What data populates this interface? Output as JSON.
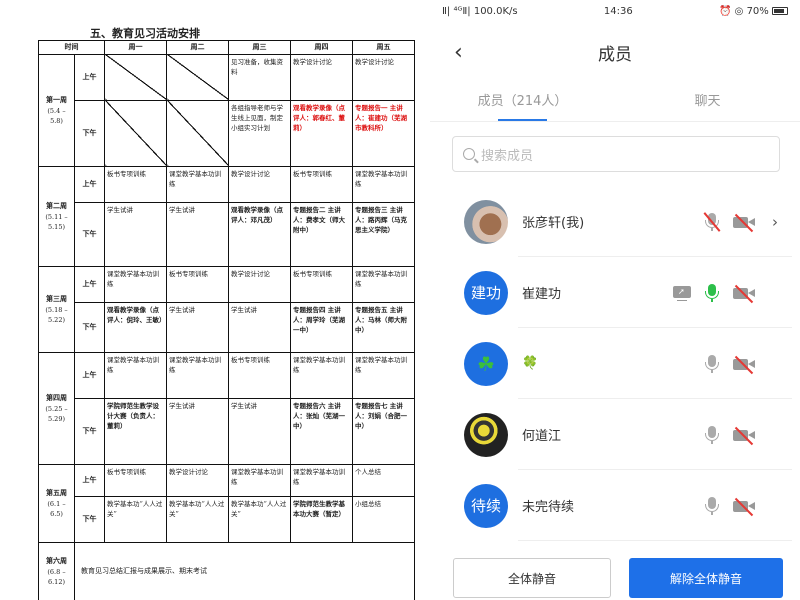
{
  "document": {
    "title": "五、教育见习活动安排",
    "headers": [
      "时间",
      "周一",
      "周二",
      "周三",
      "周四",
      "周五"
    ],
    "am": "上午",
    "pm": "下午",
    "weeks": [
      {
        "name": "第一周",
        "range": "(5.4 –5.8)",
        "am": [
          "",
          "",
          "见习准备，收集资料",
          "教学设计讨论",
          "教学设计讨论"
        ],
        "pm": [
          "",
          "",
          "各组指导老师与学生线上见面，制定小组实习计划",
          "观看教学录像（点评人：郭春红、董莉）",
          "专题报告一 主讲人：崔建功（芜湖市教科所）"
        ]
      },
      {
        "name": "第二周",
        "range": "(5.11 –5.15)",
        "am": [
          "板书专项训练",
          "课堂教学基本功训练",
          "教学设计讨论",
          "板书专项训练",
          "课堂教学基本功训练"
        ],
        "pm": [
          "学生试讲",
          "学生试讲",
          "观看教学录像（点评人：邓凡茂）",
          "专题报告二 主讲人：费孝文（师大附中）",
          "专题报告三 主讲人：路丙辉（马克思主义学院）"
        ]
      },
      {
        "name": "第三周",
        "range": "(5.18 –5.22)",
        "am": [
          "课堂教学基本功训练",
          "板书专项训练",
          "教学设计讨论",
          "板书专项训练",
          "课堂教学基本功训练"
        ],
        "pm": [
          "观看教学录像（点评人：倪玲、王敏）",
          "学生试讲",
          "学生试讲",
          "专题报告四 主讲人：周学玲（芜湖一中）",
          "专题报告五 主讲人：马林（师大附中）"
        ]
      },
      {
        "name": "第四周",
        "range": "(5.25 –5.29)",
        "am": [
          "课堂教学基本功训练",
          "课堂教学基本功训练",
          "板书专项训练",
          "课堂教学基本功训练",
          "课堂教学基本功训练"
        ],
        "pm": [
          "学院师范生教学设计大赛（负责人：董莉）",
          "学生试讲",
          "学生试讲",
          "专题报告六 主讲人：张灿（芜湖一中）",
          "专题报告七 主讲人：刘娟（合肥一中）"
        ]
      },
      {
        "name": "第五周",
        "range": "(6.1 –6.5)",
        "am": [
          "板书专项训练",
          "教学设计讨论",
          "课堂教学基本功训练",
          "课堂教学基本功训练",
          "个人总结"
        ],
        "pm": [
          "教学基本功“人人过关”",
          "教学基本功“人人过关”",
          "教学基本功“人人过关”",
          "学院师范生教学基本功大赛（暂定）",
          "小组总结"
        ]
      },
      {
        "name": "第六周",
        "range": "(6.8 –6.12)",
        "merged": "教育见习总结汇报与成果展示、期末考试"
      }
    ]
  },
  "status_bar": {
    "left": "Ⅱ| ⁴ᴳⅡ| 100.0K/s",
    "time": "14:36",
    "battery": "70%"
  },
  "header": {
    "title": "成员",
    "back": "‹"
  },
  "tabs": [
    {
      "label": "成员（214人）"
    },
    {
      "label": "聊天"
    }
  ],
  "search": {
    "placeholder": "搜索成员"
  },
  "members": [
    {
      "avatar_text": "",
      "name": "张彦轩(我)",
      "mic": "muted",
      "camera": "off",
      "screen": false,
      "chevron": "›"
    },
    {
      "avatar_text": "建功",
      "name": "崔建功",
      "mic": "active",
      "camera": "off",
      "screen": true
    },
    {
      "avatar_text": "",
      "name": "🍀",
      "mic": "normal",
      "camera": "off",
      "screen": false
    },
    {
      "avatar_text": "",
      "name": "何道江",
      "mic": "normal",
      "camera": "off",
      "screen": false
    },
    {
      "avatar_text": "待续",
      "name": "未完待续",
      "mic": "normal",
      "camera": "off",
      "screen": false
    }
  ],
  "footer": {
    "mute_all": "全体静音",
    "unmute_all": "解除全体静音"
  },
  "colors": {
    "accent": "#1e70e8",
    "active_mic": "#2cbf4a",
    "muted": "#e53935",
    "doc_red": "#d11111"
  }
}
